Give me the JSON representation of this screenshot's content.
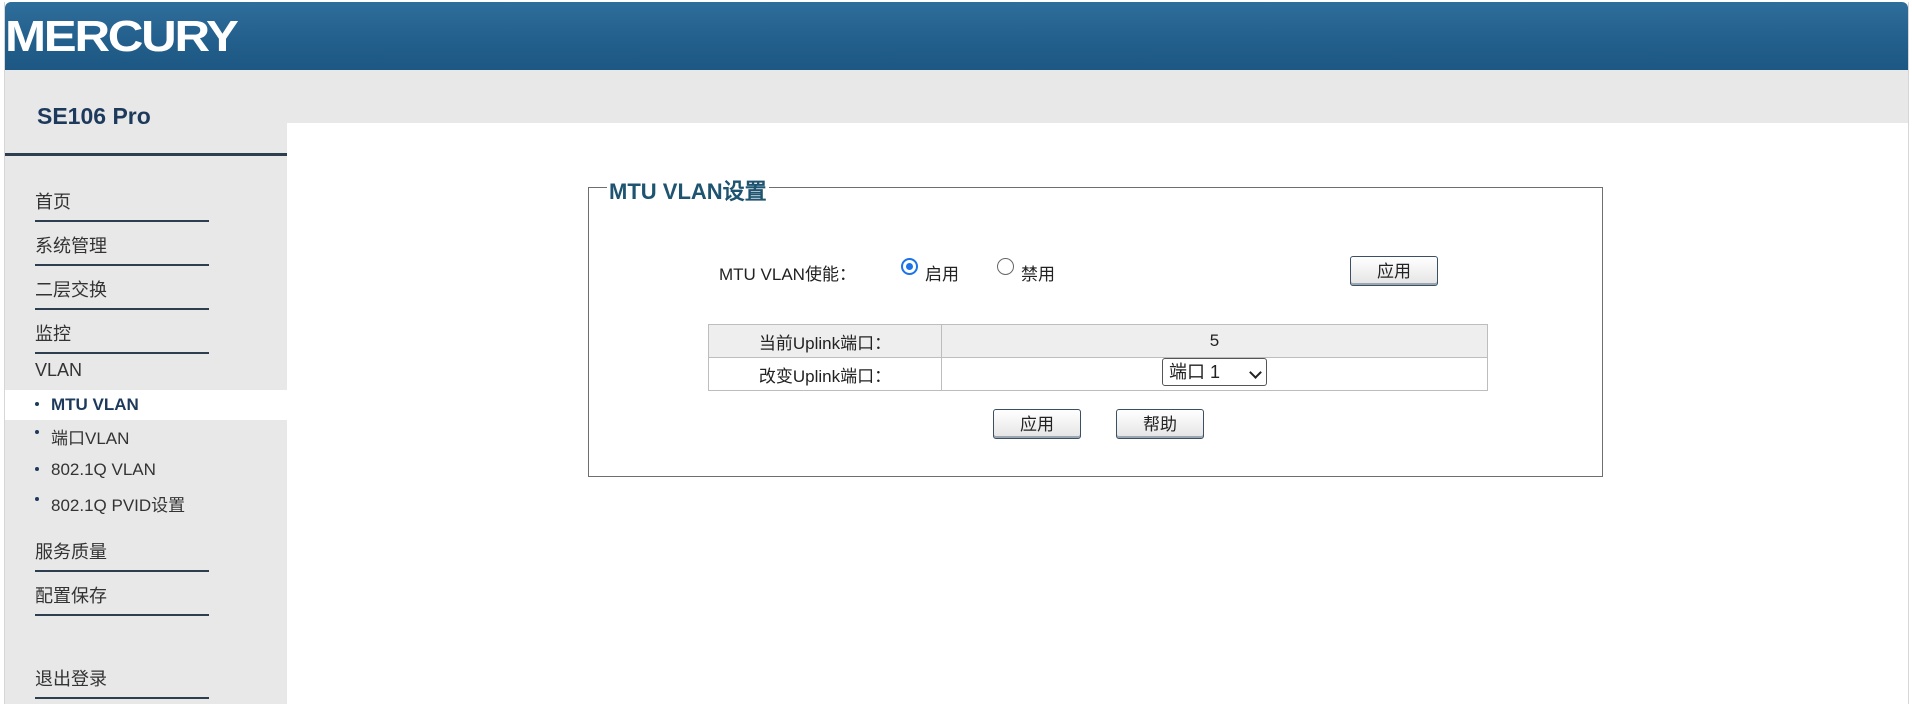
{
  "header": {
    "brand": "MERCURY"
  },
  "sidebar": {
    "model": "SE106 Pro",
    "nav": {
      "home": "首页",
      "system": "系统管理",
      "l2": "二层交换",
      "monitor": "监控",
      "vlan": "VLAN",
      "qos": "服务质量",
      "save": "配置保存",
      "logout": "退出登录"
    },
    "vlan_sub": {
      "mtu": "MTU VLAN",
      "port": "端口VLAN",
      "q": "802.1Q VLAN",
      "pvid": "802.1Q PVID设置"
    }
  },
  "main": {
    "legend": "MTU VLAN设置",
    "enable_label": "MTU VLAN使能：",
    "radio_enable": "启用",
    "radio_disable": "禁用",
    "enabled": true,
    "apply_top": "应用",
    "rows": {
      "current_label": "当前Uplink端口：",
      "current_value": "5",
      "change_label": "改变Uplink端口：",
      "change_value": "端口 1"
    },
    "apply_bottom": "应用",
    "help": "帮助"
  },
  "colors": {
    "header": "#25628f",
    "sidebar": "#e8e8e8",
    "accent": "#1e5470"
  }
}
